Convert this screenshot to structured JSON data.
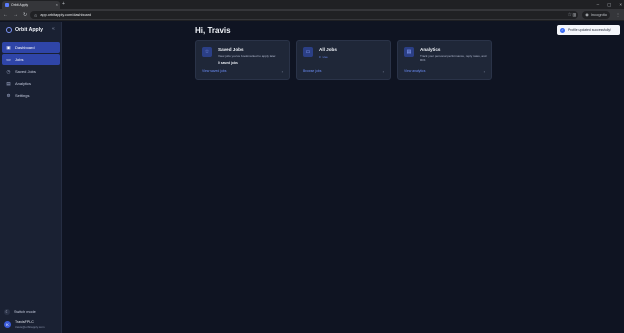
{
  "browser": {
    "tab_title": "Orbit Apply",
    "tab_close": "×",
    "new_tab": "+",
    "win_minimize": "–",
    "win_maximize": "▢",
    "win_close": "×",
    "back": "←",
    "forward": "→",
    "reload": "↻",
    "url": "app.orbitapply.com/dashboard",
    "incognito_label": "Incognito",
    "menu": "⋮"
  },
  "sidebar": {
    "brand": "Orbit Apply",
    "collapse": "«",
    "items": [
      {
        "label": "Dashboard",
        "icon": "▣",
        "active": true
      },
      {
        "label": "Jobs",
        "icon": "▭",
        "active": true
      },
      {
        "label": "Saved Jobs",
        "icon": "◷",
        "active": false
      },
      {
        "label": "Analytics",
        "icon": "▤",
        "active": false
      },
      {
        "label": "Settings",
        "icon": "⚙",
        "active": false
      }
    ],
    "switch_mode": "Switch mode",
    "user": {
      "initial": "K",
      "name": "TravisFPLC",
      "email": "travis@orbitapply.com"
    }
  },
  "main": {
    "greeting": "Hi, Travis",
    "cards": [
      {
        "title": "Saved Jobs",
        "description": "View jobs you've bookmarked to apply later.",
        "stat": "0 saved jobs",
        "link": "View saved jobs",
        "icon": "☆"
      },
      {
        "title": "All Jobs",
        "badge_count": "0",
        "badge_label": "Live",
        "link": "Browse jobs",
        "icon": "▭"
      },
      {
        "title": "Analytics",
        "description": "Track your personal performance, reply rates, and ROI.",
        "link": "View analytics",
        "icon": "▤"
      }
    ],
    "arrow": "›"
  },
  "toast": {
    "message": "Profile updated successfully!",
    "icon": "✓"
  },
  "colors": {
    "background": "#0f1422",
    "sidebar": "#1a2133",
    "card": "#1f2738",
    "accent": "#2f45a8",
    "link": "#6b8df7"
  }
}
